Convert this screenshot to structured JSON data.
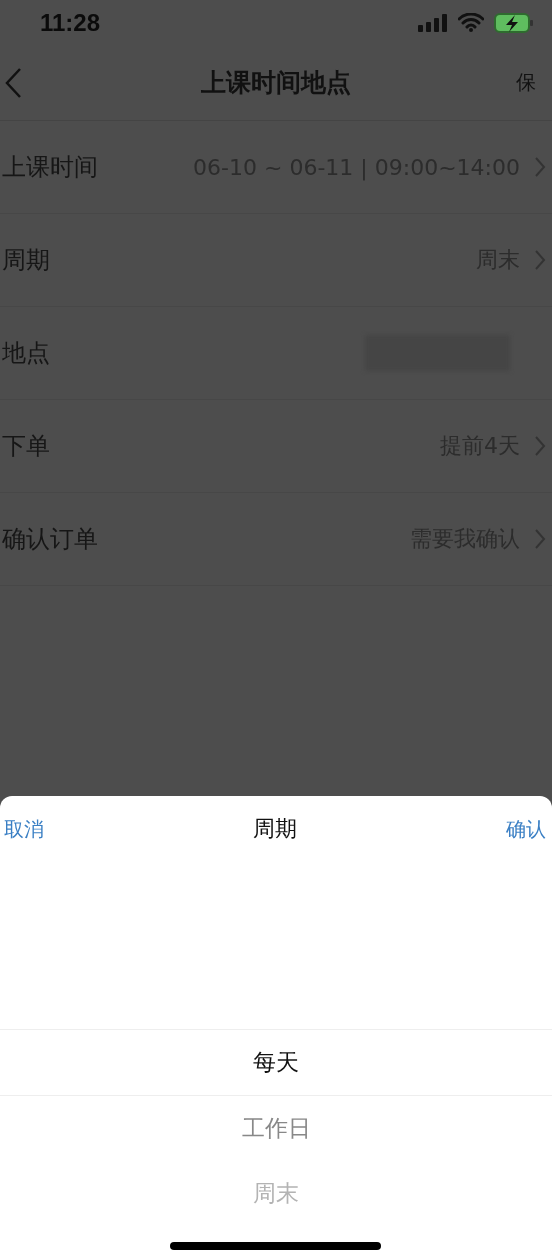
{
  "status_bar": {
    "time": "11:28"
  },
  "nav": {
    "title": "上课时间地点",
    "action": "保"
  },
  "rows": [
    {
      "label": "上课时间",
      "value": "06-10 ~ 06-11 | 09:00~14:00",
      "kind": "text"
    },
    {
      "label": "周期",
      "value": "周末",
      "kind": "text"
    },
    {
      "label": "地点",
      "kind": "redacted"
    },
    {
      "label": "下单",
      "value": "提前4天",
      "kind": "text"
    },
    {
      "label": "确认订单",
      "value": "需要我确认",
      "kind": "text"
    }
  ],
  "sheet": {
    "cancel": "取消",
    "title": "周期",
    "confirm": "确认",
    "options": [
      {
        "label": "每天",
        "selected": true
      },
      {
        "label": "工作日",
        "selected": false
      },
      {
        "label": "周末",
        "selected": false
      }
    ]
  }
}
